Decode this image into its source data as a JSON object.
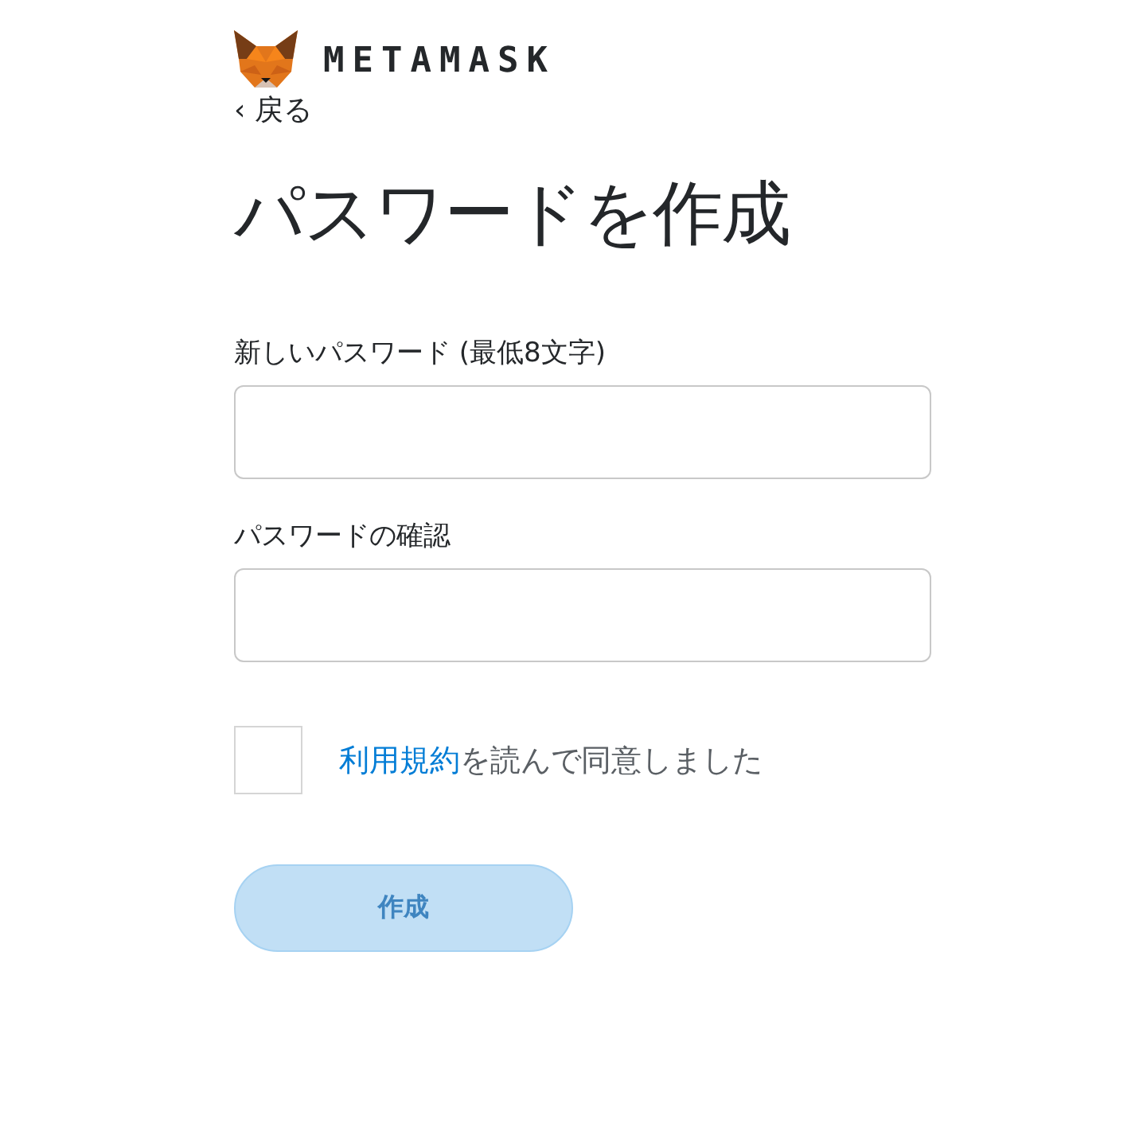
{
  "header": {
    "logo_text": "METAMASK",
    "back_link": "‹ 戻る"
  },
  "title": "パスワードを作成",
  "fields": [
    {
      "label": "新しいパスワード (最低8文字)"
    },
    {
      "label": "パスワードの確認"
    }
  ],
  "terms": {
    "checked": false,
    "link": "利用規約",
    "text": "を読んで同意しました"
  },
  "submit": {
    "label": "作成",
    "disabled": true
  }
}
